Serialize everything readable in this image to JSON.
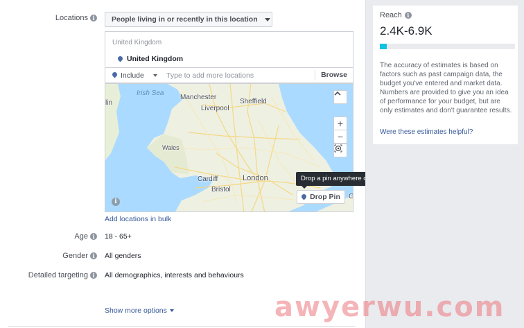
{
  "locations": {
    "label": "Locations",
    "type_dropdown": "People living in or recently in this location",
    "country_header": "United Kingdom",
    "selected_location": "United Kingdom",
    "include_label": "Include",
    "input_placeholder": "Type to add more locations",
    "browse_label": "Browse",
    "map": {
      "labels": {
        "irish_sea": "Irish Sea",
        "manchester": "Manchester",
        "liverpool": "Liverpool",
        "sheffield": "Sheffield",
        "wales": "Wales",
        "cardiff": "Cardiff",
        "bristol": "Bristol",
        "london": "London",
        "edge_lin": "lin",
        "edge_g": "G"
      },
      "zoom_in": "+",
      "zoom_out": "−",
      "collapse": "^",
      "drop_pin_label": "Drop Pin",
      "tooltip": "Drop a pin anywhere on the map"
    },
    "bulk_link": "Add locations in bulk"
  },
  "age": {
    "label": "Age",
    "value": "18 - 65+"
  },
  "gender": {
    "label": "Gender",
    "value": "All genders"
  },
  "detailed_targeting": {
    "label": "Detailed targeting",
    "value": "All demographics, interests and behaviours"
  },
  "show_more": "Show more options",
  "reach": {
    "title": "Reach",
    "value": "2.4K-6.9K",
    "bar_fill_fraction": 0.05,
    "description": "The accuracy of estimates is based on factors such as past campaign data, the budget you've entered and market data. Numbers are provided to give you an idea of performance for your budget, but are only estimates and don't guarantee results.",
    "feedback_link": "Were these estimates helpful?"
  },
  "watermark": "awyerwu.com",
  "colors": {
    "accent_link": "#365899",
    "reach_bar": "#11c2e3",
    "pin": "#4a6aa5",
    "tooltip_bg": "#282c33"
  }
}
